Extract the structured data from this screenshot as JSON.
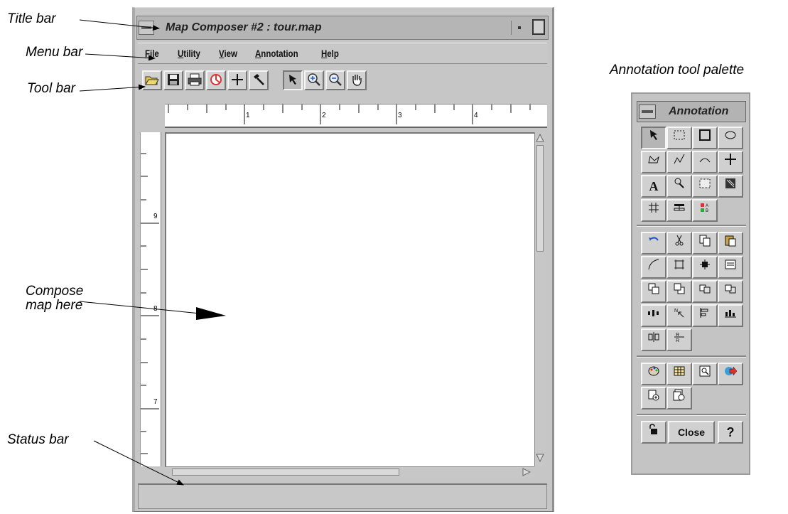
{
  "callouts": {
    "title_bar": "Title bar",
    "menu_bar": "Menu bar",
    "tool_bar": "Tool bar",
    "compose_line1": "Compose",
    "compose_line2": "map here",
    "status_bar": "Status bar"
  },
  "window": {
    "title": "Map Composer #2 : tour.map"
  },
  "menu": {
    "items": [
      {
        "label_first": "F",
        "label_rest": "ile"
      },
      {
        "label_first": "U",
        "label_rest": "tility"
      },
      {
        "label_first": "V",
        "label_rest": "iew"
      },
      {
        "label_first": "A",
        "label_rest": "nnotation"
      },
      {
        "label_first": "H",
        "label_rest": "elp"
      }
    ]
  },
  "toolbar": {
    "tools": [
      "open-folder-icon",
      "save-icon",
      "print-icon",
      "color-wheel-icon",
      "crosshair-icon",
      "hammer-icon",
      "select-arrow-icon",
      "zoom-in-icon",
      "zoom-out-icon",
      "pan-hand-icon"
    ],
    "selected": "select-arrow-icon"
  },
  "rulers": {
    "h_labels": [
      "1",
      "2",
      "3",
      "4"
    ],
    "v_labels": [
      "9",
      "8",
      "7"
    ]
  },
  "palette": {
    "caption": "Annotation tool palette",
    "title": "Annotation",
    "close_label": "Close",
    "help_label": "?"
  }
}
